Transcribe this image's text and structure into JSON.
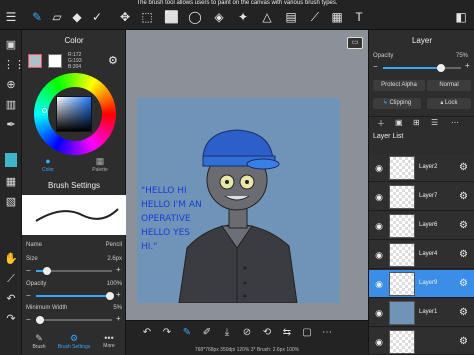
{
  "tooltip": "The brush tool allows users to paint on the canvas with various brush types.",
  "toolbar": {
    "icons": [
      "menu-icon",
      "brush-icon",
      "eraser-icon",
      "fill-icon",
      "selection-icon",
      "move-icon",
      "transform-icon",
      "lasso-icon",
      "fill-tool-icon",
      "shape-icon",
      "gradient-icon",
      "text-icon",
      "layers-icon"
    ]
  },
  "color_panel": {
    "title": "Color",
    "rgb": {
      "r": "R:172",
      "g": "G:193",
      "b": "B:204"
    },
    "tabs": [
      {
        "label": "Color"
      },
      {
        "label": "Palette"
      }
    ]
  },
  "brush_panel": {
    "title": "Brush Settings",
    "name_label": "Name",
    "name_value": "Pencil",
    "size_label": "Size",
    "size_value": "2.6px",
    "opacity_label": "Opacity",
    "opacity_value": "100%",
    "min_width_label": "Minimum Width",
    "min_width_value": "5%",
    "size_level": 0.15,
    "opacity_level": 1.0,
    "min_width_level": 0.05
  },
  "bottom_left_tabs": [
    {
      "label": "Brush"
    },
    {
      "label": "Brush Settings"
    },
    {
      "label": "More"
    }
  ],
  "status_bar": "768*768px 350dpi 120% 3* Brush: 2.6px 100%",
  "artwork": {
    "lines": [
      "\"HELLO HI",
      "HELLO I'M AN",
      "OPERATIVE",
      "HELLO YES",
      "HI.\""
    ],
    "text_color": "#1a3bd6",
    "bg_color": "#6f94b7"
  },
  "layer_panel": {
    "title": "Layer",
    "opacity_label": "Opacity",
    "opacity_value": "75%",
    "opacity_level": 0.75,
    "blend_mode": "Normal",
    "protect_alpha": "Protect Alpha",
    "clipping": "Clipping",
    "lock": "Lock",
    "layer_list_title": "Layer List",
    "layers": [
      {
        "name": "Layer2",
        "selected": false
      },
      {
        "name": "Layer7",
        "selected": false
      },
      {
        "name": "Layer6",
        "selected": false
      },
      {
        "name": "Layer4",
        "selected": false
      },
      {
        "name": "Layer9",
        "selected": true
      },
      {
        "name": "Layer1",
        "selected": false
      }
    ]
  },
  "colors": {
    "accent": "#34a8ff",
    "primary_swatch": "#acc1cc",
    "secondary_swatch": "#ffffff",
    "selected_layer": "#3b8ee8"
  }
}
